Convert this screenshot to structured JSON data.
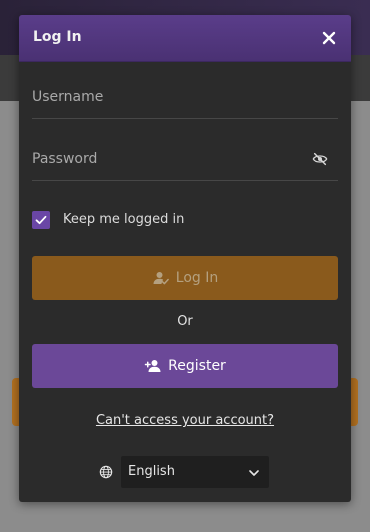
{
  "modal": {
    "title": "Log In"
  },
  "form": {
    "username_placeholder": "Username",
    "password_placeholder": "Password",
    "keep_logged_in_label": "Keep me logged in",
    "keep_logged_in_checked": true,
    "login_button_label": "Log In",
    "or_label": "Or",
    "register_button_label": "Register",
    "cant_access_link": "Can't access your account?"
  },
  "language": {
    "selected": "English"
  },
  "icons": {
    "close": "close-icon",
    "password_visibility": "eye-off-icon",
    "checkbox": "check-icon",
    "login": "user-check-icon",
    "register": "user-plus-icon",
    "language": "globe-icon",
    "dropdown": "chevron-down-icon"
  },
  "colors": {
    "header_purple": "#4a3173",
    "login_button": "#8a5a1c",
    "register_button": "#6b4898",
    "modal_bg": "#2b2b2b"
  }
}
